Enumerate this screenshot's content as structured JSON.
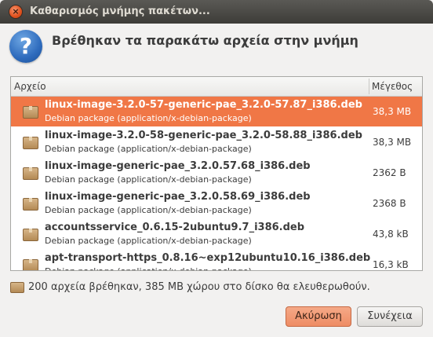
{
  "window": {
    "title": "Καθαρισμός μνήμης πακέτων...",
    "close_glyph": "×"
  },
  "header": {
    "icon": "question-icon",
    "icon_glyph": "?",
    "message": "Βρέθηκαν τα παρακάτω αρχεία στην μνήμη"
  },
  "list": {
    "columns": {
      "file": "Αρχείο",
      "size": "Μέγεθος"
    },
    "rows": [
      {
        "name": "linux-image-3.2.0-57-generic-pae_3.2.0-57.87_i386.deb",
        "type": "Debian package (application/x-debian-package)",
        "size": "38,3 MB",
        "selected": true
      },
      {
        "name": "linux-image-3.2.0-58-generic-pae_3.2.0-58.88_i386.deb",
        "type": "Debian package (application/x-debian-package)",
        "size": "38,3 MB",
        "selected": false
      },
      {
        "name": "linux-image-generic-pae_3.2.0.57.68_i386.deb",
        "type": "Debian package (application/x-debian-package)",
        "size": "2362 B",
        "selected": false
      },
      {
        "name": "linux-image-generic-pae_3.2.0.58.69_i386.deb",
        "type": "Debian package (application/x-debian-package)",
        "size": "2368 B",
        "selected": false
      },
      {
        "name": "accountsservice_0.6.15-2ubuntu9.7_i386.deb",
        "type": "Debian package (application/x-debian-package)",
        "size": "43,8 kB",
        "selected": false
      },
      {
        "name": "apt-transport-https_0.8.16~exp12ubuntu10.16_i386.deb",
        "type": "Debian package (application/x-debian-package)",
        "size": "16,3 kB",
        "selected": false
      }
    ]
  },
  "summary": {
    "icon": "package-icon",
    "text": "200 αρχεία βρέθηκαν, 385 MB χώρου στο δίσκο θα ελευθερωθούν."
  },
  "buttons": {
    "cancel": "Ακύρωση",
    "continue": "Συνέχεια"
  },
  "colors": {
    "selection": "#f07746",
    "titlebar": "#3d3c38",
    "background": "#f2f1f0"
  }
}
